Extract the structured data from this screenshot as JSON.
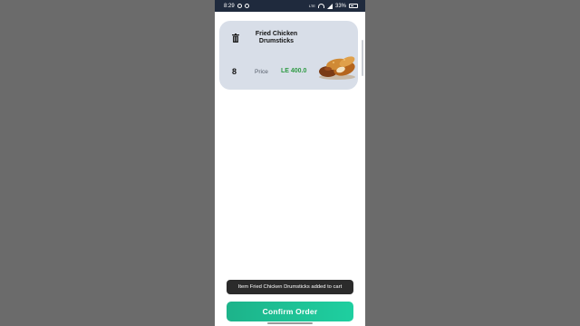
{
  "status_bar": {
    "time": "8:29",
    "network_label": "LTE",
    "battery": "33%"
  },
  "cart": {
    "items": [
      {
        "name": "Fried Chicken Drumsticks",
        "quantity": "8",
        "price_label": "Price",
        "price": "LE 400.0"
      }
    ]
  },
  "toast": {
    "message": "Item Fried Chicken Drumsticks added to cart"
  },
  "actions": {
    "confirm_label": "Confirm Order"
  },
  "colors": {
    "accent": "#1ecf9f",
    "price": "#2e9a43",
    "card_bg": "#d8dee8",
    "status_bar": "#1f2a3d"
  },
  "icons": [
    "whatsapp-icon",
    "messenger-icon",
    "wifi-icon",
    "signal-icon",
    "battery-icon",
    "trash-icon"
  ]
}
